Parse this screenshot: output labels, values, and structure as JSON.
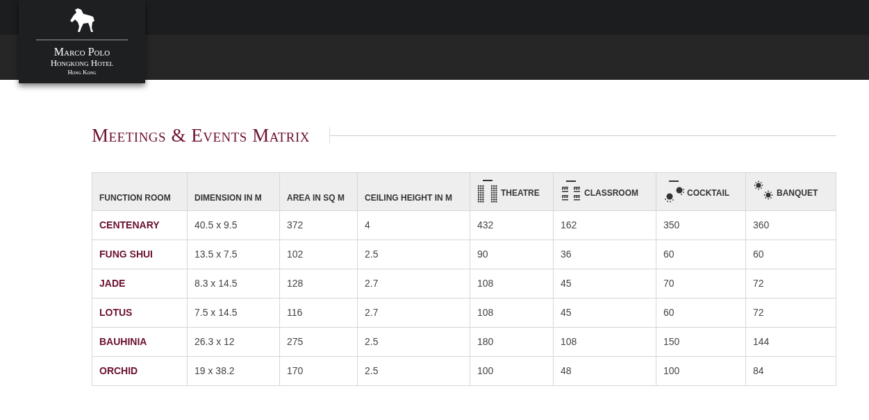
{
  "logo": {
    "name": "Marco Polo",
    "subtitle": "Hongkong Hotel",
    "location": "Hong Kong"
  },
  "title": "Meetings & Events Matrix",
  "table": {
    "columns": [
      {
        "label": "FUNCTION ROOM",
        "kind": "text"
      },
      {
        "label": "DIMENSION IN M",
        "kind": "text"
      },
      {
        "label": "AREA IN SQ M",
        "kind": "text"
      },
      {
        "label": "CEILING HEIGHT IN M",
        "kind": "text"
      },
      {
        "label": "THEATRE",
        "kind": "theatre"
      },
      {
        "label": "CLASSROOM",
        "kind": "classroom"
      },
      {
        "label": "COCKTAIL",
        "kind": "cocktail"
      },
      {
        "label": "BANQUET",
        "kind": "banquet"
      }
    ],
    "rows": [
      [
        "CENTENARY",
        "40.5 x 9.5",
        "372",
        "4",
        "432",
        "162",
        "350",
        "360"
      ],
      [
        "FUNG SHUI",
        "13.5 x 7.5",
        "102",
        "2.5",
        "90",
        "36",
        "60",
        "60"
      ],
      [
        "JADE",
        "8.3 x 14.5",
        "128",
        "2.7",
        "108",
        "45",
        "70",
        "72"
      ],
      [
        "LOTUS",
        "7.5 x 14.5",
        "116",
        "2.7",
        "108",
        "45",
        "60",
        "72"
      ],
      [
        "BAUHINIA",
        "26.3 x 12",
        "275",
        "2.5",
        "180",
        "108",
        "150",
        "144"
      ],
      [
        "ORCHID",
        "19 x 38.2",
        "170",
        "2.5",
        "100",
        "48",
        "100",
        "84"
      ]
    ]
  }
}
